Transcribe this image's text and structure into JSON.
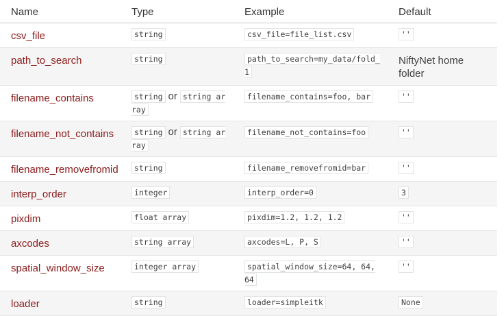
{
  "table": {
    "headers": {
      "name": "Name",
      "type": "Type",
      "example": "Example",
      "default": "Default"
    },
    "rows": [
      {
        "name": "csv_file",
        "type": [
          "string"
        ],
        "example": "csv_file=file_list.csv",
        "default": "''",
        "default_code": true
      },
      {
        "name": "path_to_search",
        "type": [
          "string"
        ],
        "example": "path_to_search=my_data/fold_1",
        "default": "NiftyNet home folder",
        "default_code": false
      },
      {
        "name": "filename_contains",
        "type": [
          "string",
          "string array"
        ],
        "type_joiner": "or",
        "example": "filename_contains=foo, bar",
        "default": "''",
        "default_code": true
      },
      {
        "name": "filename_not_contains",
        "type": [
          "string",
          "string array"
        ],
        "type_joiner": "or",
        "example": "filename_not_contains=foo",
        "default": "''",
        "default_code": true
      },
      {
        "name": "filename_removefromid",
        "type": [
          "string"
        ],
        "example": "filename_removefromid=bar",
        "default": "''",
        "default_code": true
      },
      {
        "name": "interp_order",
        "type": [
          "integer"
        ],
        "example": "interp_order=0",
        "default": "3",
        "default_code": true
      },
      {
        "name": "pixdim",
        "type": [
          "float array"
        ],
        "example": "pixdim=1.2, 1.2, 1.2",
        "default": "''",
        "default_code": true
      },
      {
        "name": "axcodes",
        "type": [
          "string array"
        ],
        "example": "axcodes=L, P, S",
        "default": "''",
        "default_code": true
      },
      {
        "name": "spatial_window_size",
        "type": [
          "integer array"
        ],
        "example": "spatial_window_size=64, 64, 64",
        "default": "''",
        "default_code": true
      },
      {
        "name": "loader",
        "type": [
          "string"
        ],
        "example": "loader=simpleitk",
        "default": "None",
        "default_code": true
      }
    ]
  }
}
